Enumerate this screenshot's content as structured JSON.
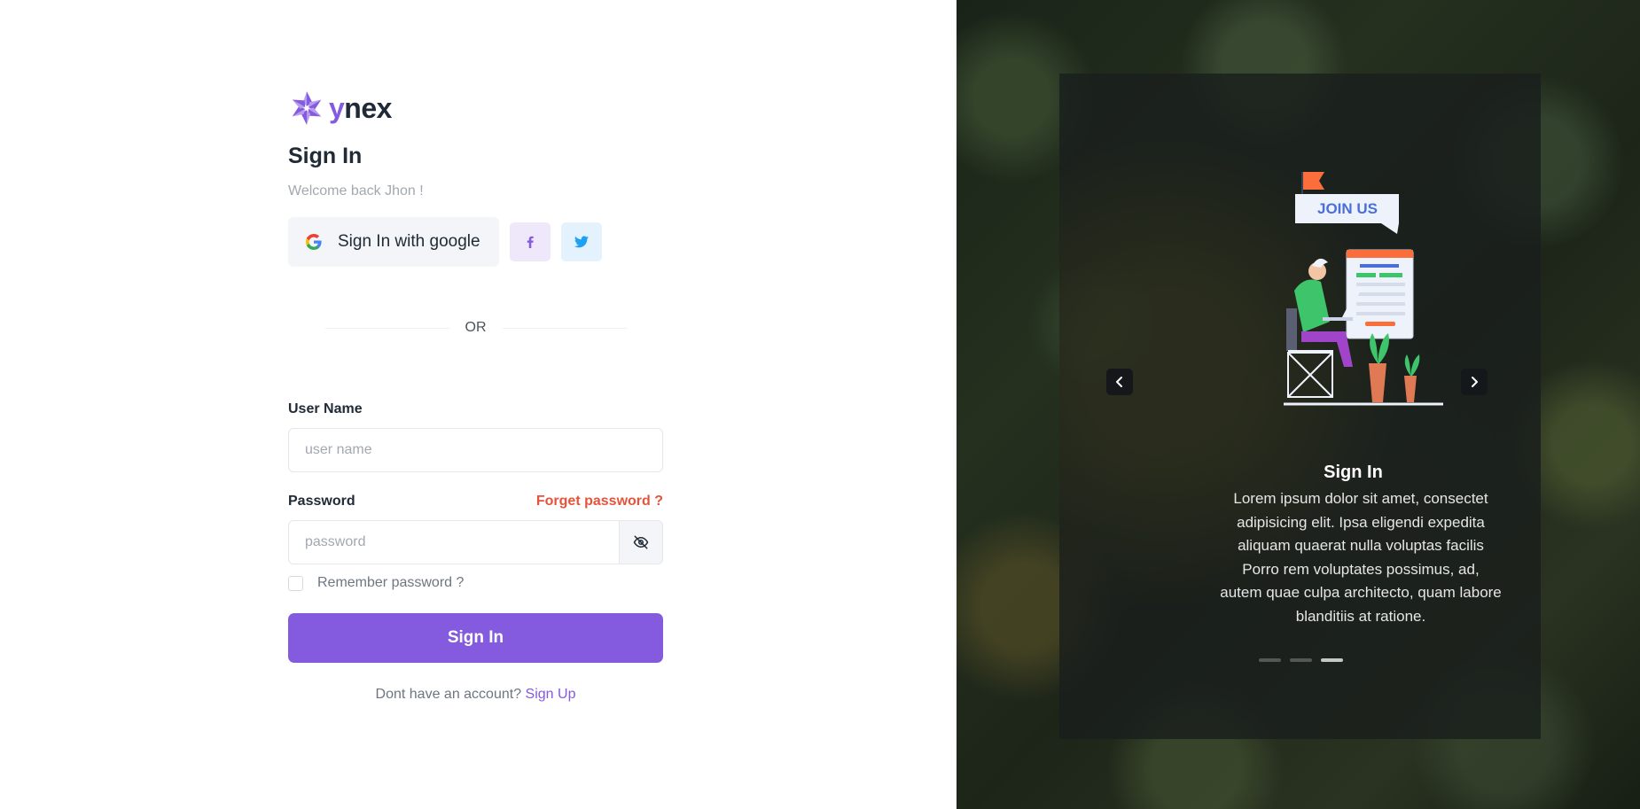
{
  "brand": {
    "logo_text_y": "y",
    "logo_text_rest": "nex"
  },
  "form": {
    "title": "Sign In",
    "subtitle": "Welcome back Jhon !",
    "google_button": "Sign In with google",
    "or_text": "OR",
    "username_label": "User Name",
    "username_placeholder": "user name",
    "password_label": "Password",
    "forgot_link": "Forget password ?",
    "password_placeholder": "password",
    "remember_label": "Remember password ?",
    "submit_label": "Sign In",
    "signup_prompt": "Dont have an account?",
    "signup_link": "Sign Up"
  },
  "carousel": {
    "illustration_text": "JOIN US",
    "slide_title": "Sign In",
    "slide_text": "Lorem ipsum dolor sit amet, consectet adipisicing elit. Ipsa eligendi expedita aliquam quaerat nulla voluptas facilis Porro rem voluptates possimus, ad, autem quae culpa architecto, quam labore blanditiis at ratione.",
    "active_slide": 3,
    "total_slides": 3
  },
  "icons": {
    "google": "google-icon",
    "facebook": "facebook-icon",
    "twitter": "twitter-icon",
    "eye_off": "eye-off-icon",
    "prev": "chevron-left-icon",
    "next": "chevron-right-icon"
  },
  "colors": {
    "primary": "#845adf",
    "danger": "#e6533c",
    "twitter": "#1da1f2"
  }
}
